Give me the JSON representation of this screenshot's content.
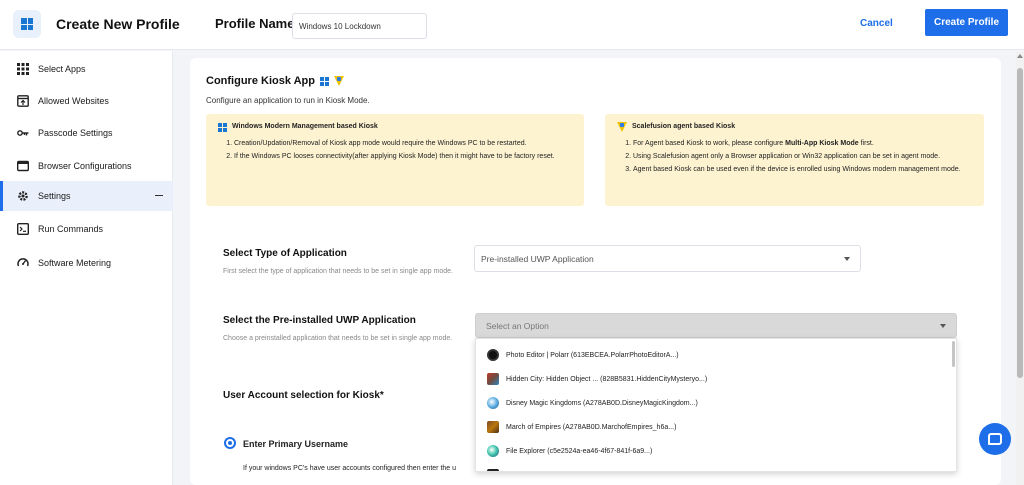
{
  "header": {
    "app_title": "Create New Profile",
    "profile_name_label": "Profile Name",
    "profile_name_value": "Windows 10 Lockdown",
    "cancel_label": "Cancel",
    "create_label": "Create Profile"
  },
  "sidebar": {
    "items": [
      {
        "label": "Select Apps",
        "icon": "grid-icon"
      },
      {
        "label": "Allowed Websites",
        "icon": "web-icon"
      },
      {
        "label": "Passcode Settings",
        "icon": "key-icon"
      },
      {
        "label": "Browser Configurations",
        "icon": "browser-icon"
      },
      {
        "label": "Settings",
        "icon": "gear-icon",
        "active": true
      },
      {
        "label": "Run Commands",
        "icon": "terminal-icon"
      },
      {
        "label": "Software Metering",
        "icon": "gauge-icon"
      }
    ]
  },
  "main": {
    "title": "Configure Kiosk App",
    "subtitle": "Configure an application to run in Kiosk Mode.",
    "left_box": {
      "title": "Windows Modern Management based Kiosk",
      "points": [
        "Creation/Updation/Removal of Kiosk app mode would require the Windows PC to be restarted.",
        "If the Windows PC looses connectivity(after applying Kiosk Mode) then it might have to be factory reset."
      ]
    },
    "right_box": {
      "title": "Scalefusion agent based Kiosk",
      "point1_pre": "For Agent based Kiosk to work, please configure ",
      "point1_bold": "Multi-App Kiosk Mode",
      "point1_post": " first.",
      "point2": "Using Scalefusion agent only a Browser application or Win32 application can be set in agent mode.",
      "point3": "Agent based Kiosk can be used even if the device is enrolled using Windows modern management mode."
    },
    "type_field": {
      "title": "Select Type of Application",
      "desc": "First select the type of application that needs to be set in single app mode.",
      "value": "Pre-installed UWP Application"
    },
    "uwp_field": {
      "title": "Select the Pre-installed UWP Application",
      "desc": "Choose a preinstalled application that needs to be set in single app mode.",
      "placeholder": "Select an Option",
      "options": [
        "Photo Editor | Polarr (613EBCEA.PolarrPhotoEditorA...)",
        "Hidden City: Hidden Object ... (828B5831.HiddenCityMysteryo...)",
        "Disney Magic Kingdoms (A278AB0D.DisneyMagicKingdom...)",
        "March of Empires (A278AB0D.MarchofEmpires_h6a...)",
        "File Explorer (c5e2524a-ea46-4f67-841f-6a9...)"
      ]
    },
    "account": {
      "title": "User Account selection for Kiosk*",
      "option_label": "Enter Primary Username",
      "option_desc": "If your windows PC's have user accounts configured then enter the u"
    }
  },
  "colors": {
    "accent": "#1d6ee8",
    "info_box_bg": "#fdf3d1",
    "active_nav_bg": "#e9f0fb"
  }
}
